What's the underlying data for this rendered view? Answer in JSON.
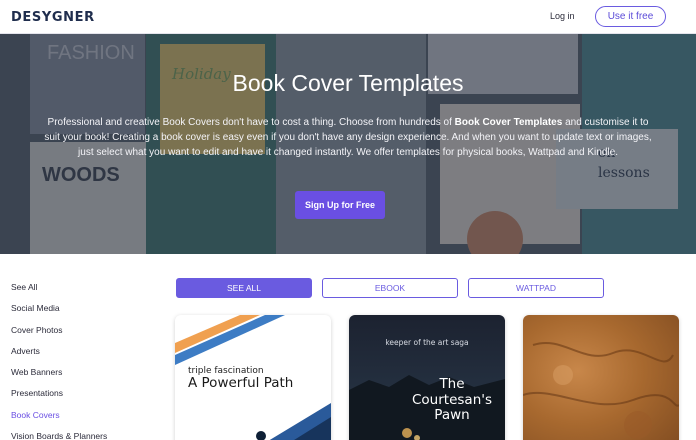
{
  "header": {
    "logo": "DESYGNER",
    "login_label": "Log in",
    "use_free_label": "Use it free"
  },
  "hero": {
    "title": "Book Cover Templates",
    "desc_part1": "Professional and creative Book Covers don't have to cost a thing. Choose from hundreds of ",
    "desc_bold": "Book Cover Templates",
    "desc_part2": " and customise it to suit your book! Creating a book cover is easy even if you don't have any design experience. And when you want to update text or images, just select what you want to edit and have it changed instantly. We offer templates for physical books, Wattpad and Kindle.",
    "signup_label": "Sign Up for Free",
    "background_words": [
      "FASHION",
      "Holiday",
      "WOODS",
      "on lessons"
    ]
  },
  "sidebar": {
    "items": [
      {
        "label": "See All"
      },
      {
        "label": "Social Media"
      },
      {
        "label": "Cover Photos"
      },
      {
        "label": "Adverts"
      },
      {
        "label": "Web Banners"
      },
      {
        "label": "Presentations"
      },
      {
        "label": "Book Covers",
        "active": true
      },
      {
        "label": "Vision Boards & Planners"
      }
    ]
  },
  "tabs": [
    {
      "label": "SEE ALL",
      "active": true
    },
    {
      "label": "EBOOK"
    },
    {
      "label": "WATTPAD"
    }
  ],
  "cards": [
    {
      "subtitle": "triple fascination",
      "title": "A Powerful Path"
    },
    {
      "subtitle": "keeper of the art saga",
      "title": "The Courtesan's Pawn"
    },
    {}
  ],
  "colors": {
    "accent": "#6a4fe3",
    "tab_accent": "#6a5be0",
    "logo": "#1f2d4d"
  }
}
